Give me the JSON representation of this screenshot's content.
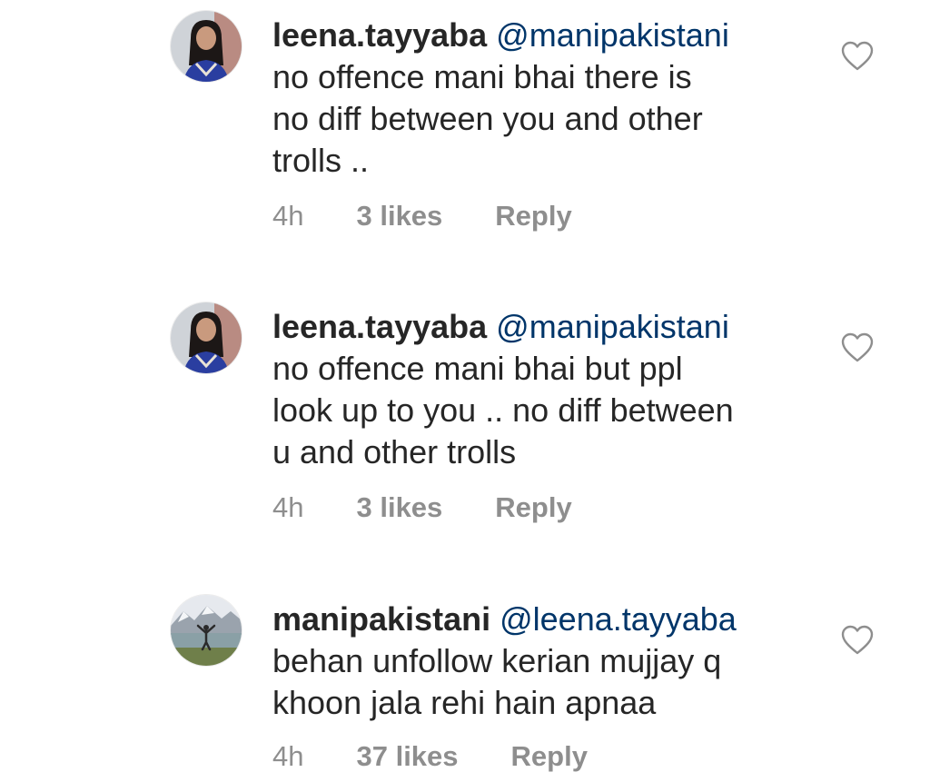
{
  "comments": [
    {
      "username": "leena.tayyaba",
      "mention": "@manipakistani",
      "lines": [
        "no offence mani bhai there is",
        "no diff between you and other",
        "trolls .."
      ],
      "time": "4h",
      "likes": "3 likes",
      "reply": "Reply",
      "avatar_icon": "woman-profile-photo",
      "like_icon": "heart-outline-icon"
    },
    {
      "username": "leena.tayyaba",
      "mention": "@manipakistani",
      "lines": [
        "no offence mani bhai but ppl",
        "look up to you .. no diff between",
        "u and other trolls"
      ],
      "time": "4h",
      "likes": "3 likes",
      "reply": "Reply",
      "avatar_icon": "woman-profile-photo",
      "like_icon": "heart-outline-icon"
    },
    {
      "username": "manipakistani",
      "mention": "@leena.tayyaba",
      "lines": [
        "behan unfollow kerian mujjay q",
        "khoon jala rehi hain apnaa"
      ],
      "time": "4h",
      "likes": "37 likes",
      "reply": "Reply",
      "avatar_icon": "mountain-landscape-profile-photo",
      "like_icon": "heart-outline-icon"
    }
  ],
  "colors": {
    "text": "#262626",
    "mention": "#003569",
    "meta": "#8e8e8e",
    "heart_stroke": "#8e8e8e"
  }
}
